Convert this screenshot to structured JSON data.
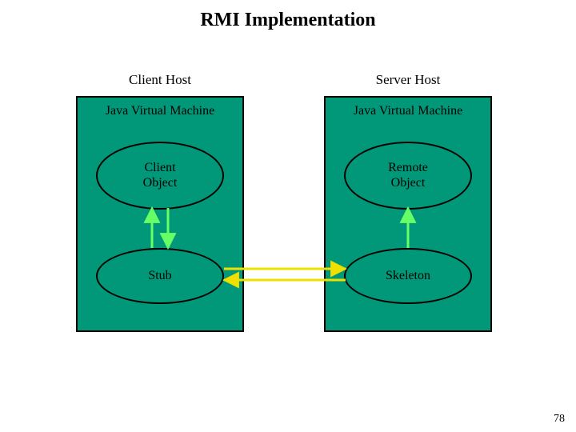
{
  "title": "RMI Implementation",
  "left": {
    "host_label": "Client Host",
    "jvm_label": "Java Virtual Machine",
    "top_object": "Client\nObject",
    "bottom_object": "Stub"
  },
  "right": {
    "host_label": "Server Host",
    "jvm_label": "Java Virtual Machine",
    "top_object": "Remote\nObject",
    "bottom_object": "Skeleton"
  },
  "colors": {
    "panel": "#009878",
    "arrow_intra": "#66ff66",
    "arrow_inter": "#f0e000"
  },
  "page_number": "78"
}
